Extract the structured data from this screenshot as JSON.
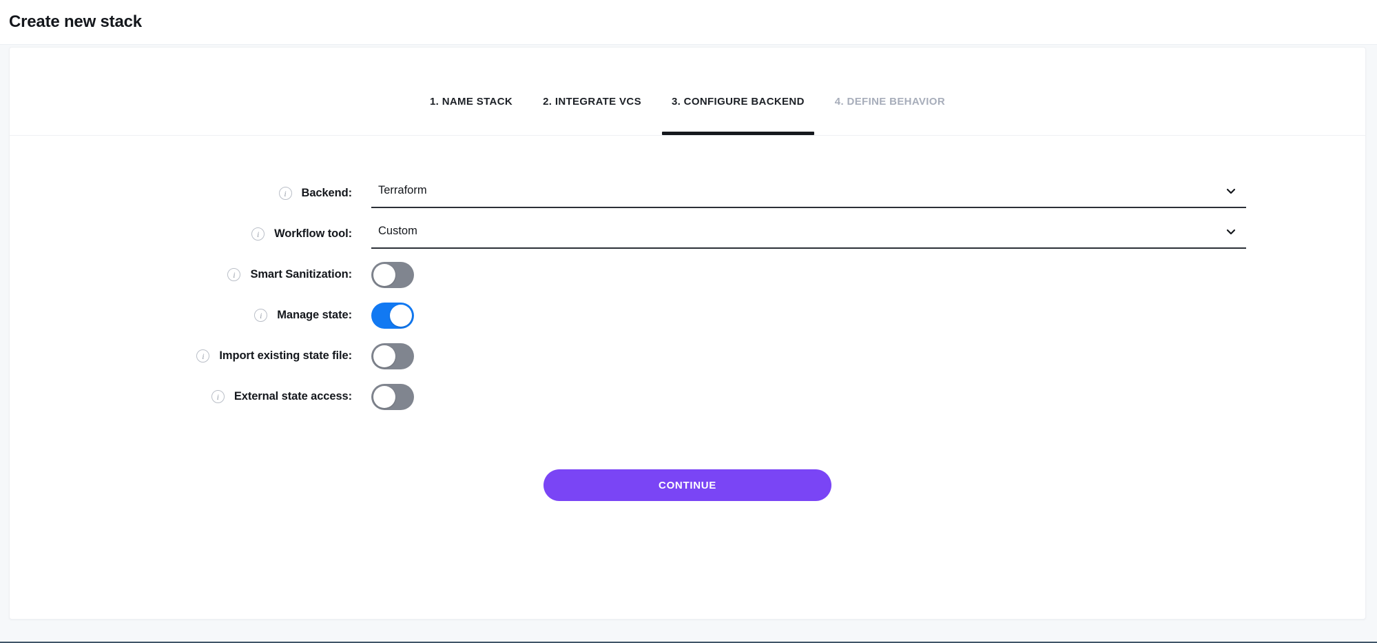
{
  "header": {
    "title": "Create new stack"
  },
  "wizard": {
    "tabs": [
      {
        "label": "1. NAME STACK",
        "state": "complete"
      },
      {
        "label": "2. INTEGRATE VCS",
        "state": "complete"
      },
      {
        "label": "3. CONFIGURE BACKEND",
        "state": "active"
      },
      {
        "label": "4. DEFINE BEHAVIOR",
        "state": "disabled"
      }
    ],
    "fields": [
      {
        "name": "backend",
        "label": "Backend:",
        "control": "select",
        "value": "Terraform",
        "info_icon": "info-circle-icon",
        "chevron_icon": "chevron-down-icon"
      },
      {
        "name": "workflow-tool",
        "label": "Workflow tool:",
        "control": "select",
        "value": "Custom",
        "info_icon": "info-circle-icon",
        "chevron_icon": "chevron-down-icon"
      },
      {
        "name": "smart-sanitization",
        "label": "Smart Sanitization:",
        "control": "toggle",
        "value": "off",
        "info_icon": "info-circle-icon"
      },
      {
        "name": "manage-state",
        "label": "Manage state:",
        "control": "toggle",
        "value": "on",
        "info_icon": "info-circle-icon"
      },
      {
        "name": "import-existing-state-file",
        "label": "Import existing state file:",
        "control": "toggle",
        "value": "off",
        "info_icon": "info-circle-icon"
      },
      {
        "name": "external-state-access",
        "label": "External state access:",
        "control": "toggle",
        "value": "off",
        "info_icon": "info-circle-icon"
      }
    ],
    "continue_label": "CONTINUE"
  },
  "colors": {
    "page_background": "#f6f8fa",
    "card_background": "#ffffff",
    "text_primary": "#14171c",
    "tab_disabled": "#a7adba",
    "tab_active_underline": "#15181d",
    "toggle_on": "#1279f2",
    "toggle_off": "#80858f",
    "continue_button": "#7a45f5",
    "bottom_rule": "#3f5467"
  }
}
